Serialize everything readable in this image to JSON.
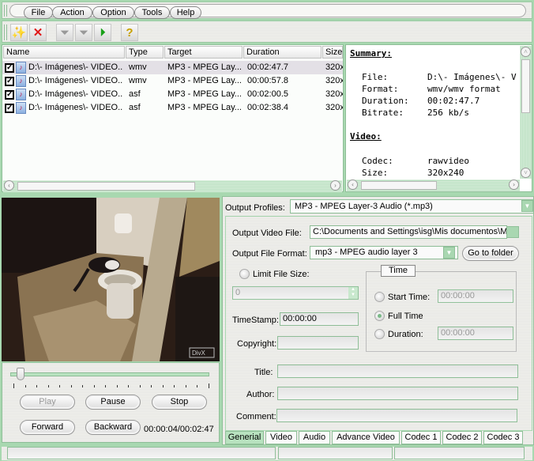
{
  "menu": {
    "items": [
      "File",
      "Action",
      "Option",
      "Tools",
      "Help"
    ]
  },
  "toolbar": {
    "buttons": [
      {
        "name": "wizard-add-icon",
        "glyph": "✨",
        "enabled": true
      },
      {
        "name": "delete-icon",
        "glyph": "✕",
        "enabled": true
      },
      {
        "name": "filter-convert-icon",
        "glyph": "⏚",
        "enabled": false
      },
      {
        "name": "filter-merge-icon",
        "glyph": "⏚",
        "enabled": false
      },
      {
        "name": "filter-start-icon",
        "glyph": "▶",
        "enabled": true
      },
      {
        "name": "help-icon",
        "glyph": "?",
        "enabled": true
      }
    ]
  },
  "filelist": {
    "columns": [
      "Name",
      "Type",
      "Target",
      "Duration",
      "Size"
    ],
    "rows": [
      {
        "checked": true,
        "name": "D:\\- Imágenes\\- VIDEO...",
        "type": "wmv",
        "target": "MP3 - MPEG Lay...",
        "duration": "00:02:47.7",
        "size": "320x",
        "selected": true
      },
      {
        "checked": true,
        "name": "D:\\- Imágenes\\- VIDEO...",
        "type": "wmv",
        "target": "MP3 - MPEG Lay...",
        "duration": "00:00:57.8",
        "size": "320x",
        "selected": false
      },
      {
        "checked": true,
        "name": "D:\\- Imágenes\\- VIDEO...",
        "type": "asf",
        "target": "MP3 - MPEG Lay...",
        "duration": "00:02:00.5",
        "size": "320x",
        "selected": false
      },
      {
        "checked": true,
        "name": "D:\\- Imágenes\\- VIDEO...",
        "type": "asf",
        "target": "MP3 - MPEG Lay...",
        "duration": "00:02:38.4",
        "size": "320x",
        "selected": false
      }
    ]
  },
  "summary": {
    "summary_heading": "Summary:",
    "file_label": "File:",
    "file_value": "D:\\- Imágenes\\- V",
    "format_label": "Format:",
    "format_value": "wmv/wmv format",
    "duration_label": "Duration:",
    "duration_value": "00:02:47.7",
    "bitrate_label": "Bitrate:",
    "bitrate_value": "256 kb/s",
    "video_heading": "Video:",
    "codec_label": "Codec:",
    "codec_value": "rawvideo",
    "size_label": "Size:",
    "size_value": "320x240"
  },
  "player": {
    "play": "Play",
    "pause": "Pause",
    "stop": "Stop",
    "forward": "Forward",
    "backward": "Backward",
    "time": "00:00:04/00:02:47",
    "progress": 0.03,
    "watermark": "DivX"
  },
  "output": {
    "profiles_label": "Output Profiles:",
    "profiles_value": "MP3 - MPEG Layer-3 Audio (*.mp3)",
    "video_file_label": "Output Video File:",
    "video_file_value": "C:\\Documents and Settings\\isg\\Mis documentos\\My",
    "file_format_label": "Output File Format:",
    "file_format_value": "mp3 - MPEG audio layer 3",
    "go_to_folder": "Go to folder",
    "limit_size_label": "Limit File Size:",
    "limit_size_value": "0",
    "timestamp_label": "TimeStamp:",
    "timestamp_value": "00:00:00",
    "copyright_label": "Copyright:",
    "copyright_value": "",
    "time_group": "Time",
    "start_time_label": "Start Time:",
    "start_time_value": "00:00:00",
    "full_time_label": "Full Time",
    "duration_label": "Duration:",
    "duration_value": "00:00:00",
    "title_label": "Title:",
    "author_label": "Author:",
    "comment_label": "Comment:"
  },
  "tabs": [
    "Generial",
    "Video",
    "Audio",
    "Advance Video",
    "Codec 1",
    "Codec 2",
    "Codec 3"
  ],
  "active_tab": 0
}
